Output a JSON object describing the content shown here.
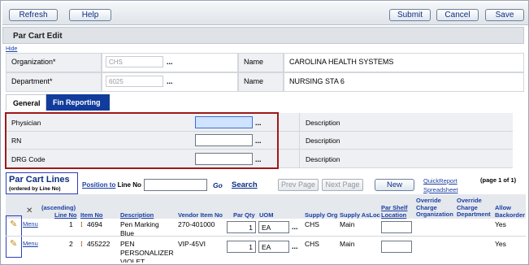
{
  "toolbar": {
    "refresh": "Refresh",
    "help": "Help",
    "submit": "Submit",
    "cancel": "Cancel",
    "save": "Save"
  },
  "page_title": "Par Cart Edit",
  "hide_link": "Hide",
  "header_fields": {
    "organization_label": "Organization*",
    "organization_value": "CHS",
    "org_name_label": "Name",
    "org_name_value": "CAROLINA HEALTH SYSTEMS",
    "department_label": "Department*",
    "department_value": "6025",
    "dept_name_label": "Name",
    "dept_name_value": "NURSING STA  6",
    "lookup": "..."
  },
  "tabs": [
    "General",
    "Fin Reporting"
  ],
  "general": {
    "physician_label": "Physician",
    "rn_label": "RN",
    "drg_label": "DRG Code",
    "description_label": "Description"
  },
  "lines_section": {
    "title": "Par Cart Lines",
    "subtitle": "(ordered by Line No)",
    "position_to": "Position to",
    "line_no_label": "Line No",
    "go": "Go",
    "search": "Search",
    "prev_page": "Prev Page",
    "next_page": "Next Page",
    "new": "New",
    "quickreport": "QuickReport",
    "spreadsheet": "Spreadsheet",
    "page_info": "(page 1 of 1)"
  },
  "columns": {
    "ascending": "(ascending)",
    "line_no": "Line No",
    "item_no": "Item No",
    "description": "Description",
    "vendor_item_no": "Vendor Item No",
    "par_qty": "Par Qty",
    "uom": "UOM",
    "supply_org": "Supply Org",
    "supply_asloc": "Supply AsLoc",
    "par_shelf_location": "Par Shelf Location",
    "override_charge_org": "Override Charge Organization",
    "override_charge_dept": "Override Charge Department",
    "allow_backorder": "Allow Backorder"
  },
  "rows": [
    {
      "menu": "Menu",
      "line_no": "1",
      "item_no": "4694",
      "description": "Pen Marking Blue",
      "vendor_item_no": "270-401000",
      "par_qty": "1",
      "uom": "EA",
      "supply_org": "CHS",
      "supply_asloc": "Main",
      "allow_backorder": "Yes"
    },
    {
      "menu": "Menu",
      "line_no": "2",
      "item_no": "455222",
      "description": "PEN PERSONALIZER-VIOLET",
      "vendor_item_no": "VIP-45VI",
      "par_qty": "1",
      "uom": "EA",
      "supply_org": "CHS",
      "supply_asloc": "Main",
      "allow_backorder": "Yes"
    }
  ],
  "colors": {
    "accent": "#123c9c",
    "link": "#1b3fa4",
    "highlight_red": "#a01818",
    "highlight_blue": "#2c3fb8"
  }
}
